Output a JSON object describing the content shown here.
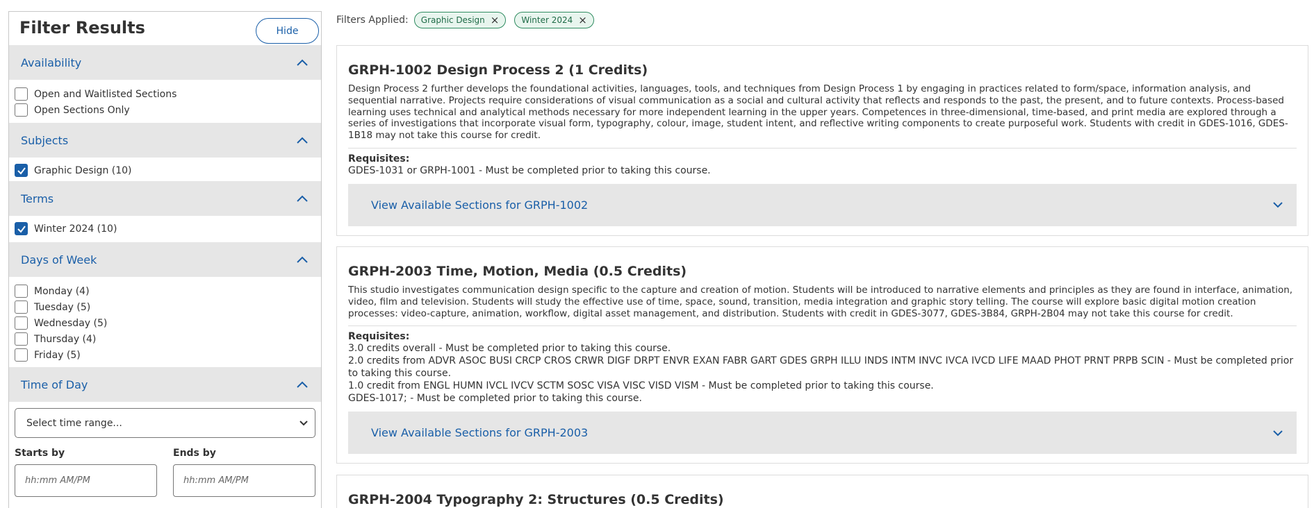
{
  "sidebar": {
    "title": "Filter Results",
    "hide_label": "Hide",
    "sections": {
      "availability": {
        "title": "Availability",
        "options": [
          "Open and Waitlisted Sections",
          "Open Sections Only"
        ]
      },
      "subjects": {
        "title": "Subjects",
        "options": [
          "Graphic Design (10)"
        ]
      },
      "terms": {
        "title": "Terms",
        "options": [
          "Winter 2024 (10)"
        ]
      },
      "days": {
        "title": "Days of Week",
        "options": [
          "Monday (4)",
          "Tuesday (5)",
          "Wednesday (5)",
          "Thursday (4)",
          "Friday (5)"
        ]
      },
      "time": {
        "title": "Time of Day",
        "select_value": "Select time range...",
        "starts_label": "Starts by",
        "ends_label": "Ends by",
        "placeholder": "hh:mm AM/PM"
      }
    }
  },
  "filters": {
    "label": "Filters Applied:",
    "chips": [
      "Graphic Design",
      "Winter 2024"
    ]
  },
  "courses": [
    {
      "title": "GRPH-1002 Design Process 2 (1 Credits)",
      "description": "Design Process 2 further develops the foundational activities, languages, tools, and techniques from Design Process 1 by engaging in practices related to form/space, information analysis, and sequential narrative. Projects require considerations of visual communication as a social and cultural activity that reflects and responds to the past, the present, and to future contexts. Process-based learning uses technical and analytical methods necessary for more independent learning in the upper years. Competences in three-dimensional, time-based, and print media are explored through a series of investigations that incorporate visual form, typography, colour, image, student intent, and reflective writing components to create purposeful work. Students with credit in GDES-1016, GDES-1B18 may not take this course for credit.",
      "requisites_label": "Requisites:",
      "requisites": [
        "GDES-1031 or GRPH-1001 - Must be completed prior to taking this course."
      ],
      "sections_label": "View Available Sections for GRPH-1002"
    },
    {
      "title": "GRPH-2003 Time, Motion, Media (0.5 Credits)",
      "description": "This studio investigates communication design specific to the capture and creation of motion. Students will be introduced to narrative elements and principles as they are found in interface, animation, video, film and television. Students will study the effective use of time, space, sound, transition, media integration and graphic story telling. The course will explore basic digital motion creation processes: video-capture, animation, workflow, digital asset management, and distribution. Students with credit in GDES-3077, GDES-3B84, GRPH-2B04 may not take this course for credit.",
      "requisites_label": "Requisites:",
      "requisites": [
        "3.0 credits overall - Must be completed prior to taking this course.",
        "2.0 credits from ADVR ASOC BUSI CRCP CROS CRWR DIGF DRPT ENVR EXAN FABR GART GDES GRPH ILLU INDS INTM INVC IVCA IVCD LIFE MAAD PHOT PRNT PRPB SCIN - Must be completed prior to taking this course.",
        "1.0 credit from ENGL HUMN IVCL IVCV SCTM SOSC VISA VISC VISD VISM - Must be completed prior to taking this course.",
        "GDES-1017; - Must be completed prior to taking this course."
      ],
      "sections_label": "View Available Sections for GRPH-2003"
    },
    {
      "title": "GRPH-2004 Typography 2: Structures (0.5 Credits)"
    }
  ],
  "colors": {
    "accent": "#1a5fa8",
    "chip_border": "#2e8b60",
    "chip_bg": "#e8f5ee",
    "section_bg": "#e6e6e6"
  },
  "icons": [
    "chevron-up-icon",
    "chevron-down-icon",
    "checkmark-icon",
    "close-icon"
  ]
}
